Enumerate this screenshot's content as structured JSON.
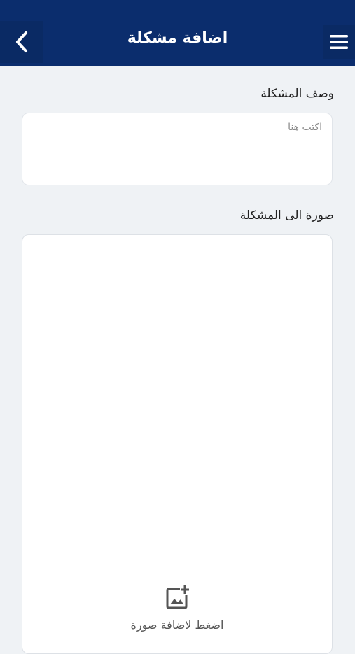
{
  "header": {
    "title": "اضافة مشكلة",
    "back_icon": "chevron-left-icon",
    "menu_icon": "hamburger-menu-icon",
    "background_color": "#0b2d6d"
  },
  "description": {
    "label": "وصف المشكلة",
    "placeholder": "اكتب هنا",
    "value": ""
  },
  "image": {
    "label": "صورة الى المشكلة",
    "icon": "add-photo-icon",
    "prompt": "اضغط لاضافة صورة"
  }
}
